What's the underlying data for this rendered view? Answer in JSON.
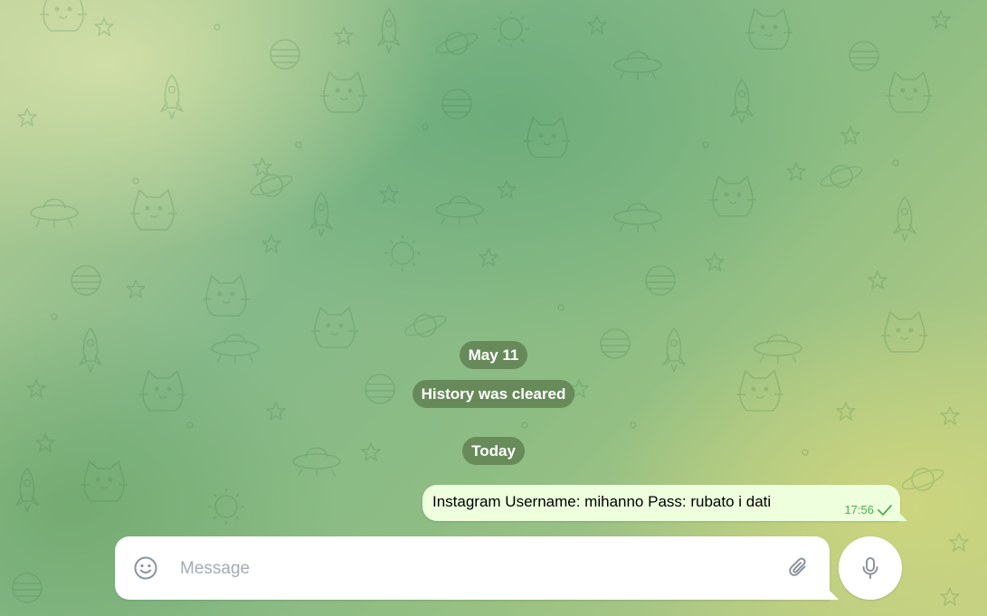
{
  "chat": {
    "service_messages": [
      {
        "label": "May 11"
      },
      {
        "label": "History was cleared"
      },
      {
        "label": "Today"
      }
    ],
    "messages": [
      {
        "direction": "outgoing",
        "text": "Instagram Username: mihanno Pass: rubato i dati",
        "time": "17:56",
        "status_icon": "single-check-icon"
      }
    ]
  },
  "composer": {
    "placeholder": "Message",
    "value": "",
    "emoji_icon": "smile-icon",
    "attach_icon": "paperclip-icon",
    "send_icon": "microphone-icon"
  },
  "colors": {
    "outgoing_bubble": "#eeffde",
    "meta_accent": "#4fae4e",
    "service_pill": "#5e7c4e",
    "icon_gray": "#8a959d"
  }
}
